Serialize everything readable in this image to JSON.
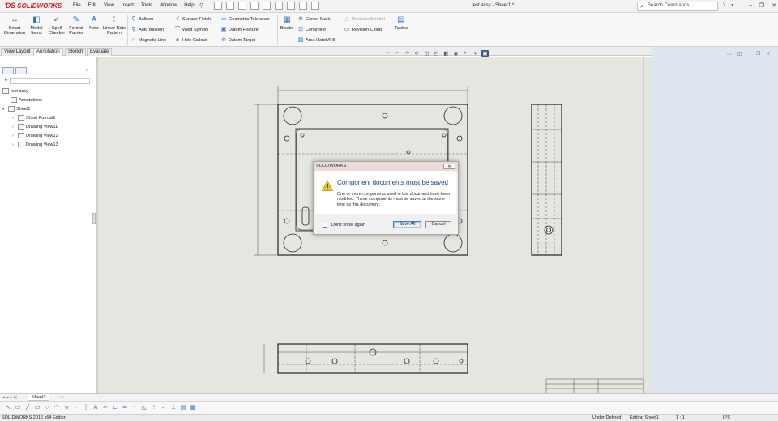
{
  "app": {
    "logo_text": "SOLIDWORKS",
    "menus": [
      "File",
      "Edit",
      "View",
      "Insert",
      "Tools",
      "Window",
      "Help"
    ],
    "document_title": "test assy - Sheet1 *",
    "search_placeholder": "Search Commands"
  },
  "ribbon": {
    "big_buttons": [
      {
        "line1": "Smart",
        "line2": "Dimension",
        "icon": "smart-dimension-icon"
      },
      {
        "line1": "Model",
        "line2": "Items",
        "icon": "model-items-icon"
      },
      {
        "line1": "Spell",
        "line2": "Checker",
        "icon": "spell-checker-icon"
      },
      {
        "line1": "Format",
        "line2": "Painter",
        "icon": "format-painter-icon"
      },
      {
        "line1": "Note",
        "line2": "",
        "icon": "note-icon"
      },
      {
        "line1": "Linear Note",
        "line2": "Pattern",
        "icon": "linear-note-pattern-icon"
      }
    ],
    "col1": [
      "Balloon",
      "Auto Balloon",
      "Magnetic Line"
    ],
    "col2": [
      "Surface Finish",
      "Weld Symbol",
      "Hole Callout"
    ],
    "col3": [
      "Geometric Tolerance",
      "Datum Feature",
      "Datum Target"
    ],
    "blocks": "Blocks",
    "col4": [
      "Center Mark",
      "Centerline",
      "Area Hatch/Fill"
    ],
    "col5": [
      "Revision Symbol",
      "Revision Cloud"
    ],
    "tables": "Tables"
  },
  "command_tabs": [
    "View Layout",
    "Annotation",
    "Sketch",
    "Evaluate"
  ],
  "feature_tree": {
    "root": "test assy",
    "items": [
      {
        "label": "Annotations",
        "level": 1
      },
      {
        "label": "Sheet1",
        "level": 0
      },
      {
        "label": "Sheet Format1",
        "level": 2
      },
      {
        "label": "Drawing View11",
        "level": 2
      },
      {
        "label": "Drawing View12",
        "level": 2
      },
      {
        "label": "Drawing View13",
        "level": 2
      }
    ]
  },
  "dialog": {
    "title": "SOLIDWORKS",
    "close": "✕",
    "heading": "Component documents must be saved",
    "message": "One or more components used in this document have been modified. These components must be saved at the same time as this document.",
    "checkbox_label": "Don't show again",
    "save_all": "Save All",
    "cancel": "Cancel"
  },
  "sheet_tabs": {
    "active": "Sheet1"
  },
  "status": {
    "edition": "SOLIDWORKS 2016 x64 Edition",
    "definition": "Under Defined",
    "editing": "Editing Sheet1",
    "scale": "1 : 1",
    "units": "IPS"
  },
  "colors": {
    "brand": "#d31f26",
    "canvas": "#e5e6df",
    "dialog_heading": "#1f3d8a"
  }
}
